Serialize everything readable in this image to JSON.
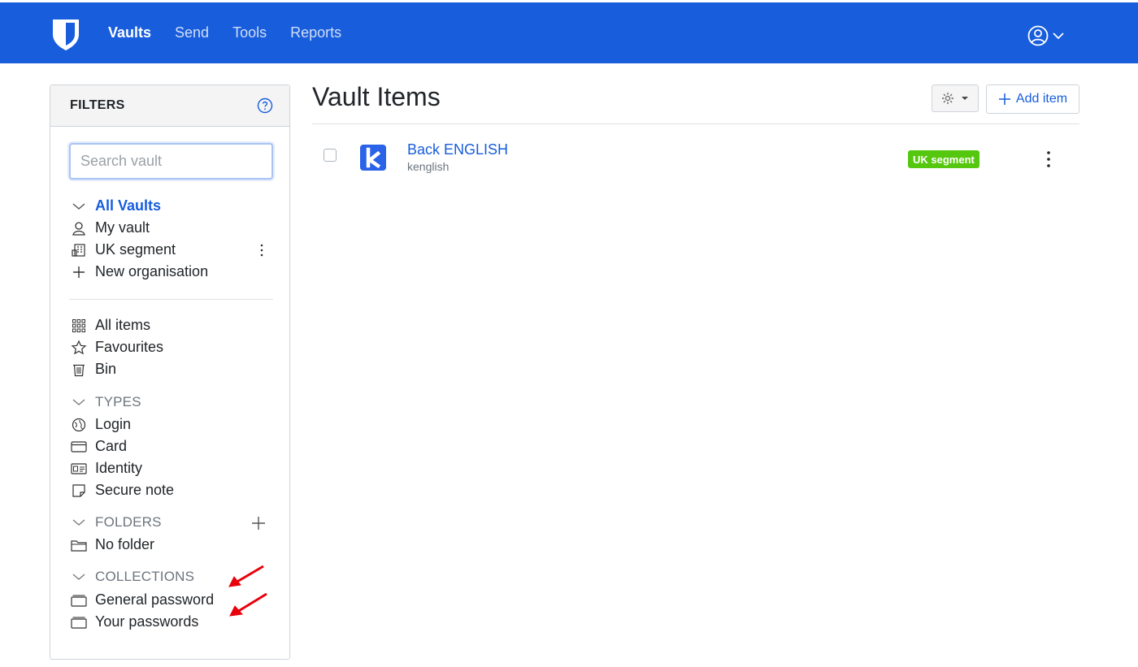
{
  "header": {
    "nav": [
      "Vaults",
      "Send",
      "Tools",
      "Reports"
    ],
    "active": "Vaults"
  },
  "filters": {
    "title": "FILTERS",
    "search_placeholder": "Search vault",
    "vaults": {
      "all": "All Vaults",
      "my": "My vault",
      "org": "UK segment",
      "new_org": "New organisation"
    },
    "general": {
      "all_items": "All items",
      "favourites": "Favourites",
      "bin": "Bin"
    },
    "types": {
      "heading": "TYPES",
      "items": [
        "Login",
        "Card",
        "Identity",
        "Secure note"
      ]
    },
    "folders": {
      "heading": "FOLDERS",
      "items": [
        "No folder"
      ]
    },
    "collections": {
      "heading": "COLLECTIONS",
      "items": [
        "General password",
        "Your passwords"
      ]
    }
  },
  "main": {
    "title": "Vault Items",
    "add_item_label": "Add item",
    "items": [
      {
        "name": "Back ENGLISH",
        "username": "kenglish",
        "badge": "UK segment"
      }
    ]
  },
  "colors": {
    "brand": "#175ddc",
    "badge": "#56c70f",
    "annotation_arrow": "#e8000b"
  }
}
